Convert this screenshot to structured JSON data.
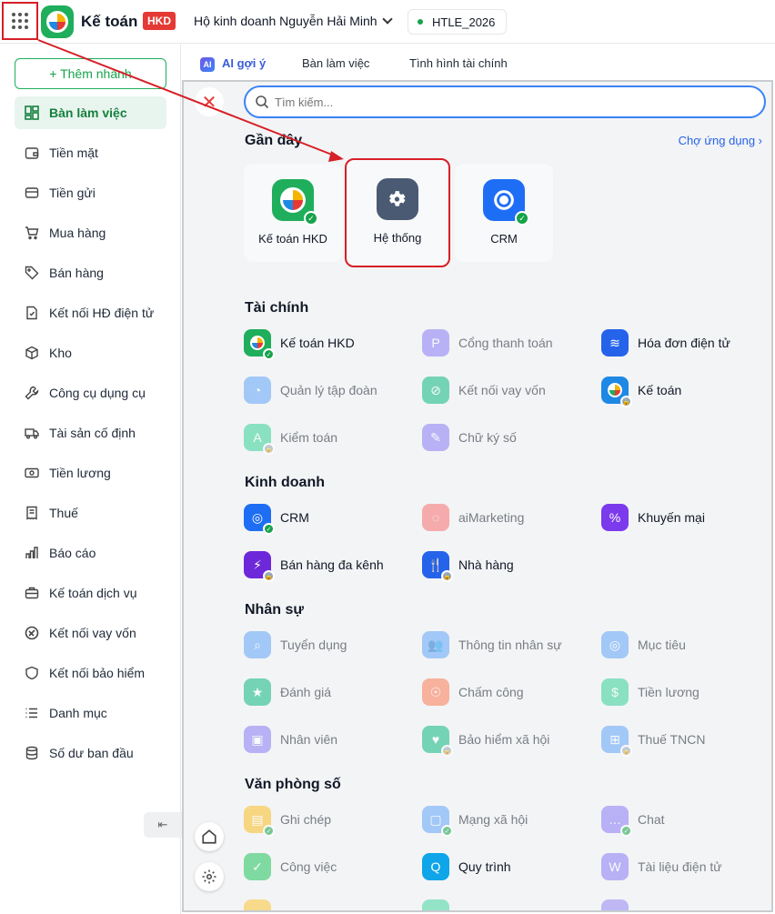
{
  "topbar": {
    "app_name": "Kế toán",
    "app_badge": "HKD",
    "business_name": "Hộ kinh doanh Nguyễn Hải Minh",
    "env_name": "HTLE_2026"
  },
  "sidebar": {
    "add_button": "+ Thêm nhánh",
    "items": [
      {
        "label": "Bàn làm việc",
        "icon": "dashboard-icon"
      },
      {
        "label": "Tiền mặt",
        "icon": "wallet-icon"
      },
      {
        "label": "Tiền gửi",
        "icon": "card-icon"
      },
      {
        "label": "Mua hàng",
        "icon": "cart-icon"
      },
      {
        "label": "Bán hàng",
        "icon": "tag-icon"
      },
      {
        "label": "Kết nối HĐ điện tử",
        "icon": "invoice-icon"
      },
      {
        "label": "Kho",
        "icon": "box-icon"
      },
      {
        "label": "Công cụ dụng cụ",
        "icon": "wrench-icon"
      },
      {
        "label": "Tài sản cố định",
        "icon": "truck-icon"
      },
      {
        "label": "Tiền lương",
        "icon": "money-icon"
      },
      {
        "label": "Thuế",
        "icon": "receipt-icon"
      },
      {
        "label": "Báo cáo",
        "icon": "chart-icon"
      },
      {
        "label": "Kế toán dịch vụ",
        "icon": "briefcase-icon"
      },
      {
        "label": "Kết nối vay vốn",
        "icon": "loan-icon"
      },
      {
        "label": "Kết nối bảo hiểm",
        "icon": "shield-icon"
      },
      {
        "label": "Danh mục",
        "icon": "list-icon"
      },
      {
        "label": "Số dư ban đầu",
        "icon": "database-icon"
      }
    ]
  },
  "tabs": {
    "ai_chip": "AI",
    "ai_label": "AI gợi ý",
    "work": "Bàn làm việc",
    "finance": "Tình hình tài chính"
  },
  "panel": {
    "search_placeholder": "Tìm kiếm...",
    "recent_title": "Gần đây",
    "store_link": "Chợ ứng dụng",
    "recent": [
      "Kế toán HKD",
      "Hệ thống",
      "CRM"
    ],
    "sections": {
      "finance": {
        "title": "Tài chính",
        "apps": [
          "Kế toán HKD",
          "Cổng thanh toán",
          "Hóa đơn điện tử",
          "Quản lý tập đoàn",
          "Kết nối vay vốn",
          "Kế toán",
          "Kiểm toán",
          "Chữ ký số"
        ]
      },
      "business": {
        "title": "Kinh doanh",
        "apps": [
          "CRM",
          "aiMarketing",
          "Khuyến mại",
          "Bán hàng đa kênh",
          "Nhà hàng"
        ]
      },
      "hr": {
        "title": "Nhân sự",
        "apps": [
          "Tuyển dụng",
          "Thông tin nhân sự",
          "Mục tiêu",
          "Đánh giá",
          "Chấm công",
          "Tiền lương",
          "Nhân viên",
          "Bảo hiểm xã hội",
          "Thuế TNCN"
        ]
      },
      "office": {
        "title": "Văn phòng số",
        "apps": [
          "Ghi chép",
          "Mạng xã hội",
          "Chat",
          "Công việc",
          "Quy trình",
          "Tài liệu điện tử"
        ]
      }
    }
  }
}
